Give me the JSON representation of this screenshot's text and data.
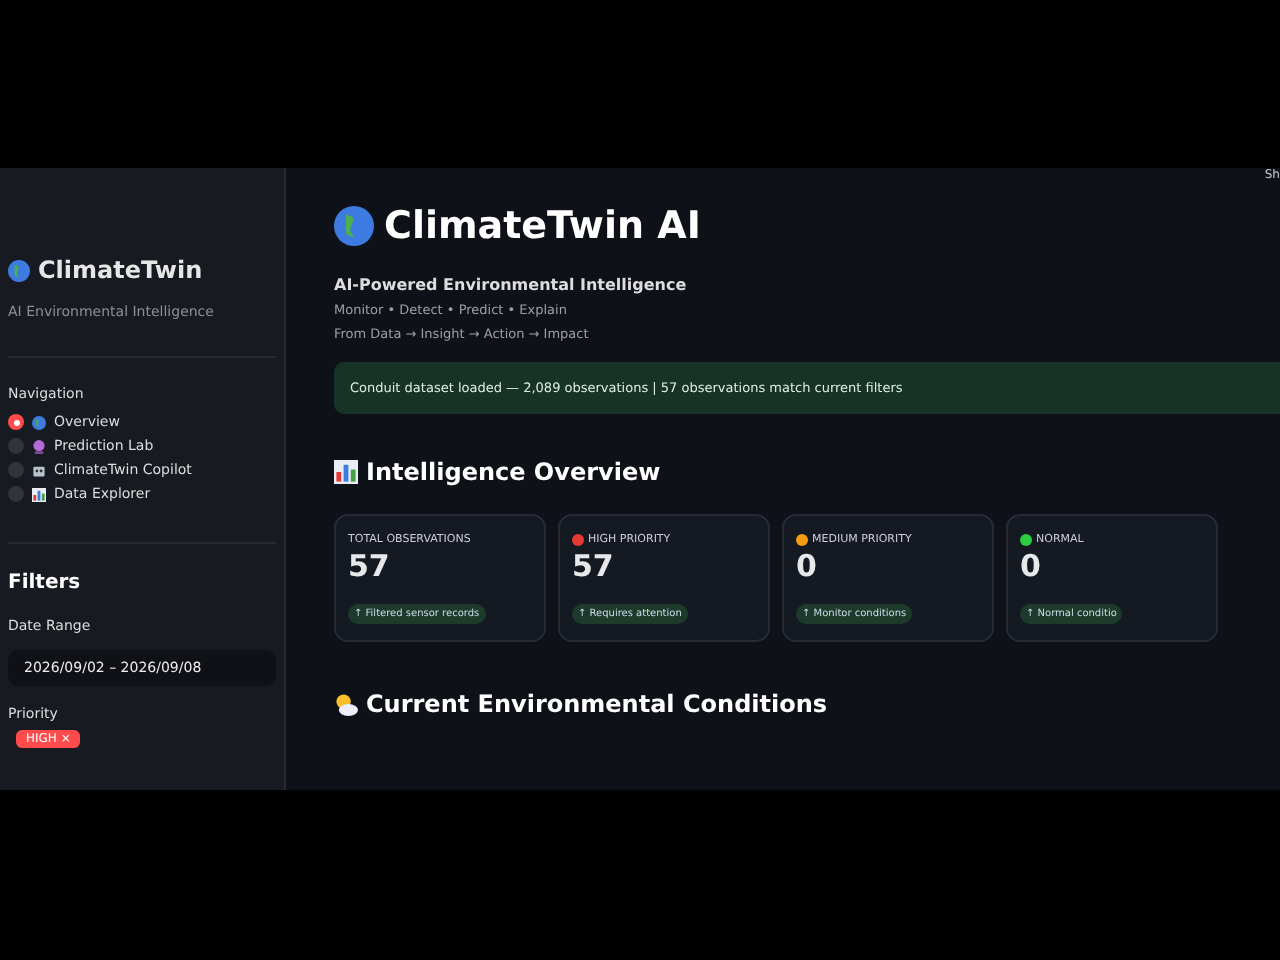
{
  "sidebar": {
    "brand": "ClimateTwin",
    "tagline": "AI Environmental Intelligence",
    "nav_title": "Navigation",
    "nav": [
      {
        "label": "Overview",
        "selected": true
      },
      {
        "label": "Prediction Lab",
        "selected": false
      },
      {
        "label": "ClimateTwin Copilot",
        "selected": false
      },
      {
        "label": "Data Explorer",
        "selected": false
      }
    ],
    "filters_title": "Filters",
    "date_label": "Date Range",
    "date_value": "2026/09/02 – 2026/09/08",
    "priority_label": "Priority",
    "priority_chips": [
      "HIGH ×"
    ]
  },
  "header_action": "Sh",
  "main": {
    "title": "ClimateTwin AI",
    "subtitle": "AI-Powered Environmental Intelligence",
    "line_1": "Monitor • Detect • Predict • Explain",
    "line_2": "From Data → Insight → Action → Impact",
    "banner": "Conduit dataset loaded — 2,089 observations | 57 observations match current filters",
    "overview_title": "Intelligence Overview",
    "metrics": [
      {
        "label": "TOTAL OBSERVATIONS",
        "value": "57",
        "delta": "↑ Filtered sensor records"
      },
      {
        "label": "HIGH PRIORITY",
        "value": "57",
        "delta": "↑ Requires attention",
        "color": "#e53935"
      },
      {
        "label": "MEDIUM PRIORITY",
        "value": "0",
        "delta": "↑ Monitor conditions",
        "color": "#f39c12"
      },
      {
        "label": "NORMAL",
        "value": "0",
        "delta": "↑ Normal conditio",
        "color": "#2ecc40"
      }
    ],
    "conditions_title": "Current Environmental Conditions"
  }
}
